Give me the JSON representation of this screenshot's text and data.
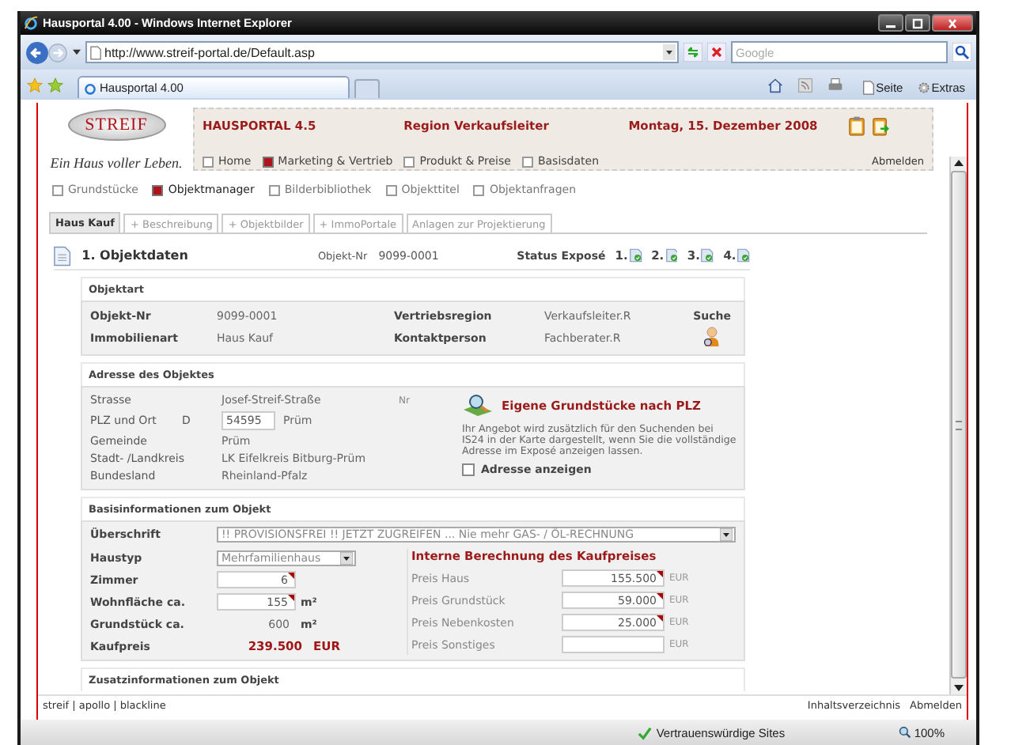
{
  "window": {
    "title": "Hausportal 4.00 - Windows Internet Explorer"
  },
  "browser": {
    "address": "http://www.streif-portal.de/Default.asp",
    "search_placeholder": "Google",
    "tab": "Hausportal 4.00",
    "tools": [
      "Seite",
      "Extras"
    ]
  },
  "header": {
    "logo": "STREIF",
    "slogan": "Ein Haus voller Leben.",
    "app": "HAUSPORTAL 4.5",
    "region": "Region Verkaufsleiter",
    "date": "Montag, 15. Dezember 2008",
    "logout": "Abmelden"
  },
  "main_nav": [
    {
      "label": "Home",
      "selected": false
    },
    {
      "label": "Marketing & Vertrieb",
      "selected": true
    },
    {
      "label": "Produkt & Preise",
      "selected": false
    },
    {
      "label": "Basisdaten",
      "selected": false
    }
  ],
  "sub_nav": [
    {
      "label": "Grundstücke",
      "selected": false
    },
    {
      "label": "Objektmanager",
      "selected": true
    },
    {
      "label": "Bilderbibliothek",
      "selected": false
    },
    {
      "label": "Objekttitel",
      "selected": false
    },
    {
      "label": "Objektanfragen",
      "selected": false
    }
  ],
  "tabs": [
    {
      "label": "Haus Kauf",
      "selected": true
    },
    {
      "label": "+ Beschreibung",
      "selected": false
    },
    {
      "label": "+ Objektbilder",
      "selected": false
    },
    {
      "label": "+ ImmoPortale",
      "selected": false
    },
    {
      "label": "Anlagen zur Projektierung",
      "selected": false
    }
  ],
  "section": {
    "title": "1. Objektdaten",
    "objekt_label": "Objekt-Nr",
    "objekt_nr": "9099-0001",
    "status_label": "Status Exposé",
    "status": [
      "1.",
      "2.",
      "3.",
      "4."
    ]
  },
  "objektart": {
    "title": "Objektart",
    "rows": [
      {
        "label": "Objekt-Nr",
        "value": "9099-0001",
        "label_2": "Vertriebsregion",
        "value_2": "Verkaufsleiter.R"
      },
      {
        "label": "Immobilienart",
        "value": "Haus Kauf",
        "label_2": "Kontaktperson",
        "value_2": "Fachberater.R"
      }
    ],
    "search": "Suche"
  },
  "adresse": {
    "title": "Adresse des Objektes",
    "rows": [
      {
        "kind": "text",
        "label": "Strasse",
        "value": "Josef-Streif-Straße",
        "extra": "Nr"
      },
      {
        "kind": "plz",
        "label": "PLZ und Ort",
        "country": "D",
        "plz": "54595",
        "value": "Prüm"
      },
      {
        "kind": "text",
        "label": "Gemeinde",
        "value": "Prüm"
      },
      {
        "kind": "text",
        "label": "Stadt- /Landkreis",
        "value": "LK Eifelkreis Bitburg-Prüm"
      },
      {
        "kind": "text",
        "label": "Bundesland",
        "value": "Rheinland-Pfalz"
      }
    ],
    "panel": {
      "title": "Eigene Grundstücke nach PLZ",
      "text": "Ihr Angebot wird zusätzlich für den Suchenden bei IS24 in der Karte dargestellt, wenn Sie die vollständige Adresse im Exposé anzeigen lassen.",
      "checkbox": {
        "label": "Adresse anzeigen",
        "checked": false
      }
    }
  },
  "basis": {
    "title": "Basisinformationen zum Objekt",
    "headline": {
      "label": "Überschrift",
      "value": "!! PROVISIONSFREI !! JETZT ZUGREIFEN ... Nie mehr GAS- / ÖL-RECHNUNG"
    },
    "rows": [
      {
        "kind": "select",
        "label": "Haustyp",
        "value": "Mehrfamilienhaus"
      },
      {
        "kind": "input",
        "label": "Zimmer",
        "value": "6",
        "flagged": true
      },
      {
        "kind": "input",
        "label": "Wohnfläche ca.",
        "value": "155",
        "unit": "m²",
        "flagged": true
      },
      {
        "kind": "text",
        "label": "Grundstück ca.",
        "value": "600",
        "unit": "m²"
      },
      {
        "kind": "total",
        "label": "Kaufpreis",
        "value": "239.500",
        "unit": "EUR"
      }
    ],
    "calc_title": "Interne Berechnung des Kaufpreises",
    "prices": [
      {
        "label": "Preis Haus",
        "value": "155.500",
        "unit": "EUR",
        "flagged": true
      },
      {
        "label": "Preis Grundstück",
        "value": "59.000",
        "unit": "EUR",
        "flagged": true
      },
      {
        "label": "Preis Nebenkosten",
        "value": "25.000",
        "unit": "EUR",
        "flagged": true
      },
      {
        "label": "Preis Sonstiges",
        "unit": "EUR",
        "flagged": false
      }
    ]
  },
  "zusatz": {
    "title": "Zusatzinformationen zum Objekt"
  },
  "footer": {
    "left": "streif | apollo | blackline",
    "links": [
      "Inhaltsverzeichnis",
      "Abmelden"
    ]
  },
  "status_bar": {
    "zone": "Vertrauenswürdige Sites",
    "zoom": "100%"
  }
}
